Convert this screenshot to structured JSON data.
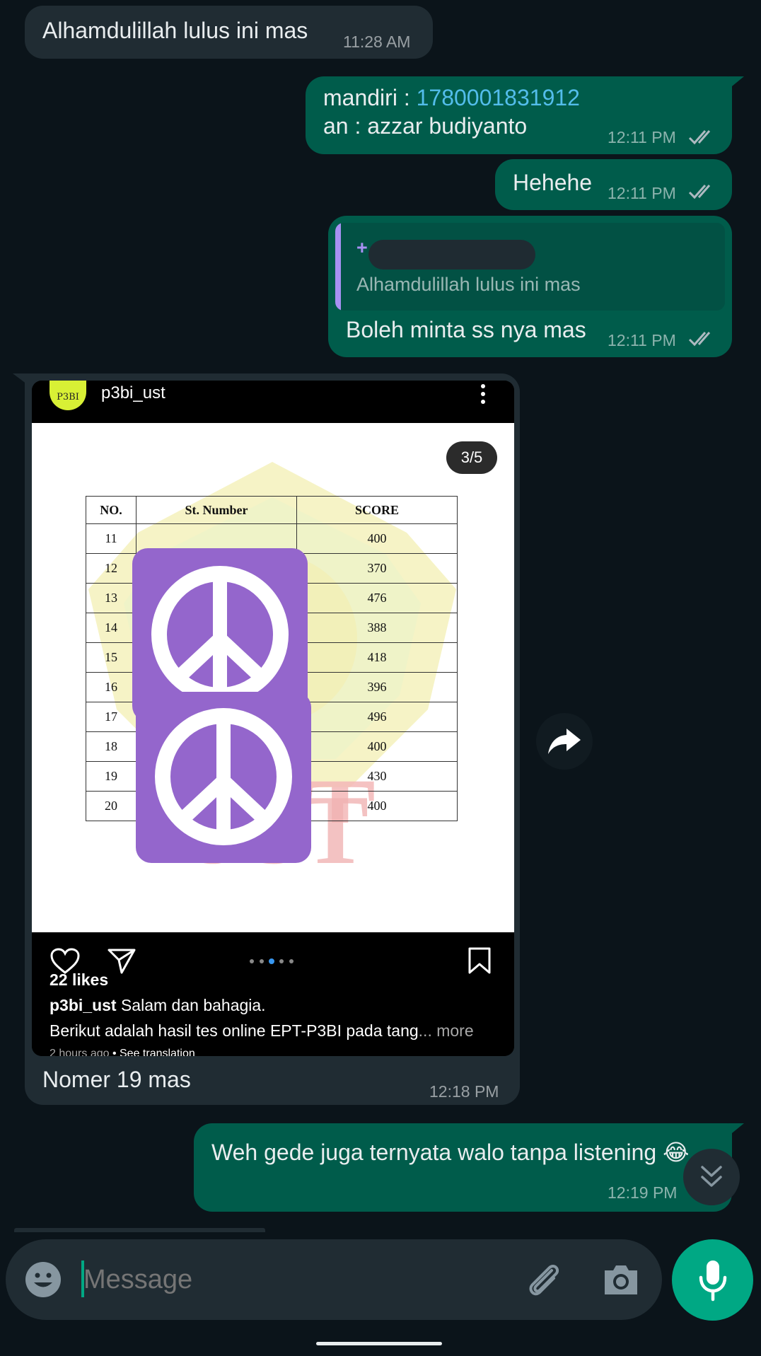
{
  "messages": [
    {
      "text": "Alhamdulillah lulus ini mas",
      "time": "11:28 AM"
    },
    {
      "bank_label": "mandiri : ",
      "account": "1780001831912",
      "line2": "an : azzar budiyanto",
      "time": "12:11 PM"
    },
    {
      "text": "Hehehe",
      "time": "12:11 PM"
    },
    {
      "quote_prefix": "+",
      "quote_text": "Alhamdulillah lulus ini mas",
      "text": "Boleh minta ss nya mas",
      "time": "12:11 PM"
    },
    {
      "text": "Nomer 19 mas",
      "time": "12:18 PM"
    },
    {
      "text": "Weh gede juga ternyata walo tanpa listening",
      "emoji": "😂",
      "time": "12:19 PM"
    }
  ],
  "instagram_post": {
    "username": "p3bi_ust",
    "avatar_text": "P3BI",
    "page_indicator": "3/5",
    "table": {
      "headers": [
        "NO.",
        "St. Number",
        "SCORE"
      ],
      "rows": [
        [
          "11",
          "",
          "400"
        ],
        [
          "12",
          "",
          "370"
        ],
        [
          "13",
          "",
          "476"
        ],
        [
          "14",
          "",
          "388"
        ],
        [
          "15",
          "",
          "418"
        ],
        [
          "16",
          "",
          "396"
        ],
        [
          "17",
          "",
          "496"
        ],
        [
          "18",
          "",
          "400"
        ],
        [
          "19",
          "",
          "430"
        ],
        [
          "20",
          "",
          "400"
        ]
      ]
    },
    "likes": "22 likes",
    "caption_user": "p3bi_ust",
    "caption_text": " Salam dan bahagia.",
    "caption_line2": "Berikut adalah hasil tes online EPT-P3BI pada tang",
    "caption_more": "... more",
    "time_ago": "2 hours ago",
    "translation_link": " • See translation"
  },
  "composer": {
    "placeholder": "Message"
  },
  "icons": [
    "emoji-icon",
    "attach-icon",
    "camera-icon",
    "mic-icon",
    "forward-icon",
    "scroll-down-icon",
    "double-check-icon",
    "heart-icon",
    "share-icon",
    "bookmark-icon",
    "peace-sticker-icon"
  ],
  "colors": {
    "background": "#0b141a",
    "incoming_bubble": "#202c33",
    "outgoing_bubble": "#005c4b",
    "accent": "#00a884",
    "link": "#53bdeb",
    "sticker": "#9466cc"
  }
}
